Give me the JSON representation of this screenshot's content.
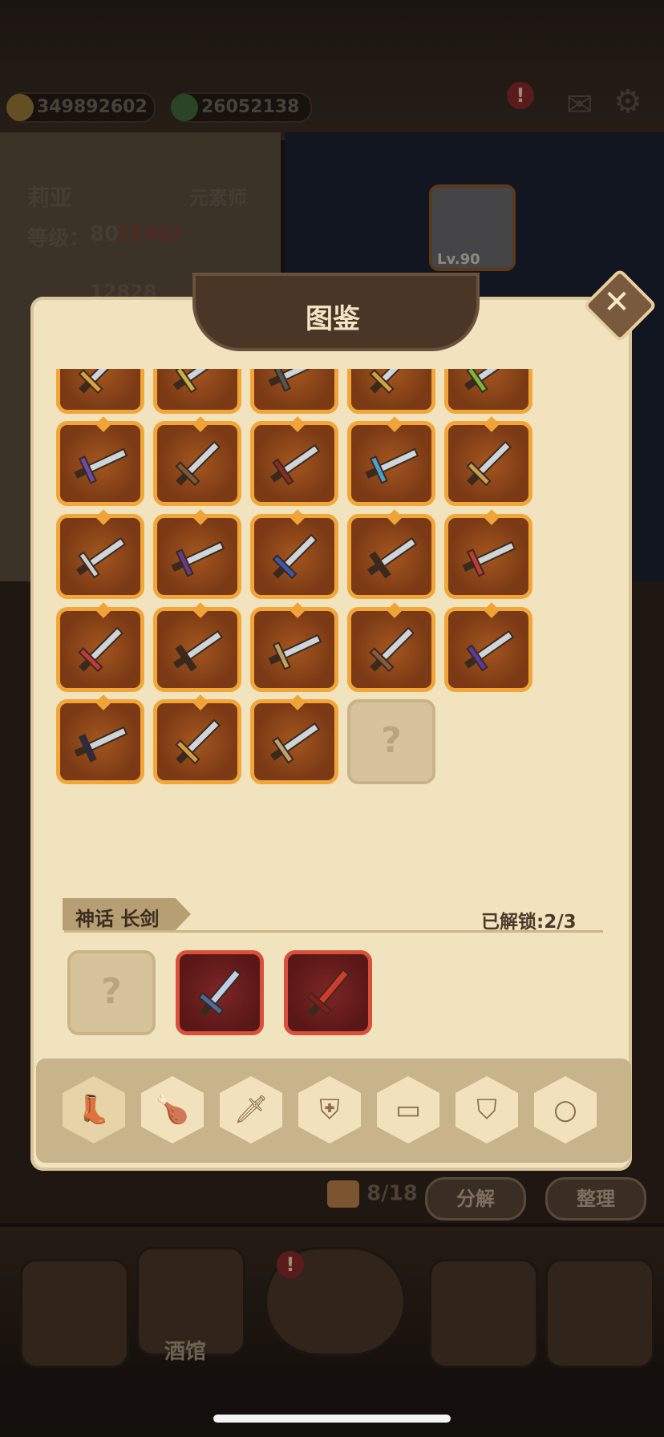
{
  "resources": {
    "gold": "349892602",
    "gem": "26052138"
  },
  "character": {
    "name": "莉亚",
    "class": "元素师",
    "level_label": "等级：",
    "level": "80",
    "level_max": "(140)",
    "stat_value": "12828",
    "hero_level": "Lv.90"
  },
  "dialog": {
    "title": "图鉴",
    "section_label": "神话 长剑",
    "unlocked": "已解锁:2/3",
    "locked_glyph": "?"
  },
  "bottom": {
    "bag_count": "8/18",
    "decompose": "分解",
    "sort": "整理",
    "tavern": "酒馆"
  },
  "alerts": {
    "top": "!",
    "nav": "!"
  },
  "category_tabs": [
    "boot-icon",
    "leg-icon",
    "sword-icon",
    "shield-icon",
    "book-icon",
    "armor-icon",
    "ring-icon"
  ],
  "colors": {
    "slot_border": "#f2a63a",
    "myth_border": "#d8503a",
    "parchment": "#f2e3bf"
  }
}
